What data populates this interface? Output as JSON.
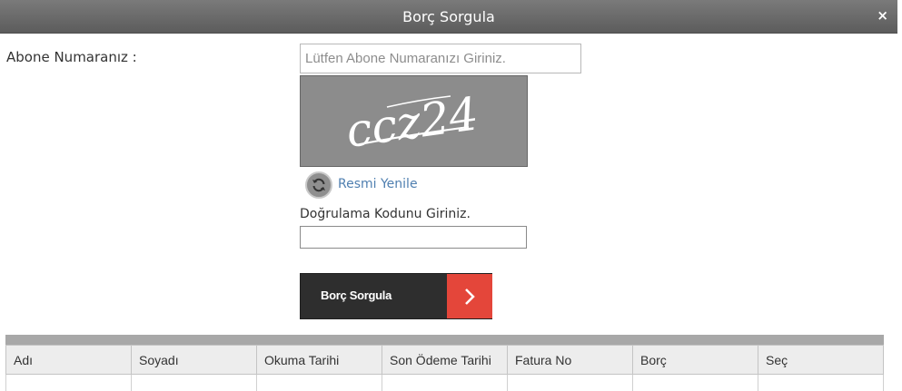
{
  "dialog": {
    "title": "Borç Sorgula",
    "close_symbol": "×"
  },
  "form": {
    "abone_label": "Abone Numaranız :",
    "abone_placeholder": "Lütfen Abone Numaranızı Giriniz.",
    "abone_value": "",
    "captcha_text": "ccz24",
    "refresh_icon": "refresh-icon",
    "refresh_label": "Resmi Yenile",
    "code_label": "Doğrulama Kodunu Giriniz.",
    "code_value": "",
    "submit_label": "Borç Sorgula",
    "submit_icon": "chevron-right-icon"
  },
  "table": {
    "columns": [
      "Adı",
      "Soyadı",
      "Okuma Tarihi",
      "Son Ödeme Tarihi",
      "Fatura No",
      "Borç",
      "Seç"
    ],
    "rows": []
  },
  "colors": {
    "titlebar": "#666666",
    "button_dark": "#2e2e2e",
    "button_accent": "#e4463a",
    "link": "#4f7fb0"
  }
}
